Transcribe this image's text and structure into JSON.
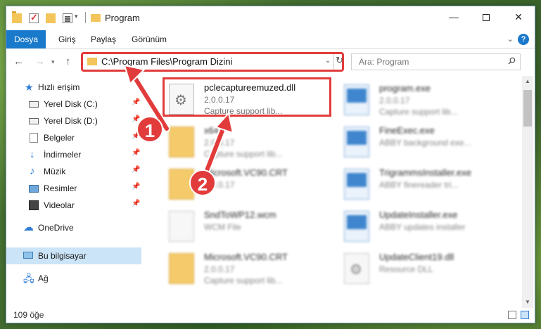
{
  "window": {
    "title": "Program",
    "minimize_label": "—",
    "close_label": "✕"
  },
  "ribbon": {
    "tabs": [
      "Dosya",
      "Giriş",
      "Paylaş",
      "Görünüm"
    ],
    "help_label": "?"
  },
  "address": {
    "path": "C:\\Program Files\\Program Dizini",
    "search_placeholder": "Ara: Program"
  },
  "sidebar": {
    "items": [
      {
        "label": "Hızlı erişim",
        "icon": "star-icon"
      },
      {
        "label": "Yerel Disk (C:)",
        "icon": "drive-icon",
        "pinned": true
      },
      {
        "label": "Yerel Disk (D:)",
        "icon": "drive-icon",
        "pinned": true
      },
      {
        "label": "Belgeler",
        "icon": "documents-icon",
        "pinned": true
      },
      {
        "label": "İndirmeler",
        "icon": "download-icon",
        "pinned": true
      },
      {
        "label": "Müzik",
        "icon": "music-icon",
        "pinned": true
      },
      {
        "label": "Resimler",
        "icon": "pictures-icon",
        "pinned": true
      },
      {
        "label": "Videolar",
        "icon": "videos-icon",
        "pinned": true
      },
      {
        "label": "OneDrive",
        "icon": "cloud-icon"
      },
      {
        "label": "Bu bilgisayar",
        "icon": "computer-icon",
        "selected": true
      },
      {
        "label": "Ağ",
        "icon": "network-icon"
      }
    ]
  },
  "files": {
    "left": [
      {
        "name": "pclecaptureemuzed.dll",
        "version": "2.0.0.17",
        "desc": "Capture support lib...",
        "icon": "dll-gear-icon"
      },
      {
        "name": "x64",
        "version": "2.0.0.17",
        "desc": "Capture support lib...",
        "icon": "folder-icon"
      },
      {
        "name": "Microsoft.VC90.CRT",
        "version": "2.0.0.17",
        "desc": "",
        "icon": "folder-icon"
      },
      {
        "name": "SndToWP12.wcm",
        "version": "WCM File",
        "desc": "",
        "icon": "document-icon"
      },
      {
        "name": "Microsoft.VC90.CRT",
        "version": "2.0.0.17",
        "desc": "Capture support lib...",
        "icon": "folder-icon"
      }
    ],
    "right": [
      {
        "name": "program.exe",
        "version": "2.0.0.17",
        "desc": "Capture support lib...",
        "icon": "exe-icon"
      },
      {
        "name": "FineExec.exe",
        "version": "ABBY background exe...",
        "desc": "",
        "icon": "exe-icon"
      },
      {
        "name": "TrigrammsInstaller.exe",
        "version": "ABBY finereader tri...",
        "desc": "",
        "icon": "exe-icon"
      },
      {
        "name": "UpdateInstaller.exe",
        "version": "ABBY updates installer",
        "desc": "",
        "icon": "exe-icon"
      },
      {
        "name": "UpdateClient19.dll",
        "version": "Resource DLL",
        "desc": "",
        "icon": "dll-gear-icon"
      }
    ]
  },
  "status": {
    "count": "109 öğe"
  },
  "callouts": [
    "1",
    "2"
  ],
  "colors": {
    "accent": "#1979ca",
    "highlight": "#e23b3b",
    "selected": "#cce4f7"
  }
}
